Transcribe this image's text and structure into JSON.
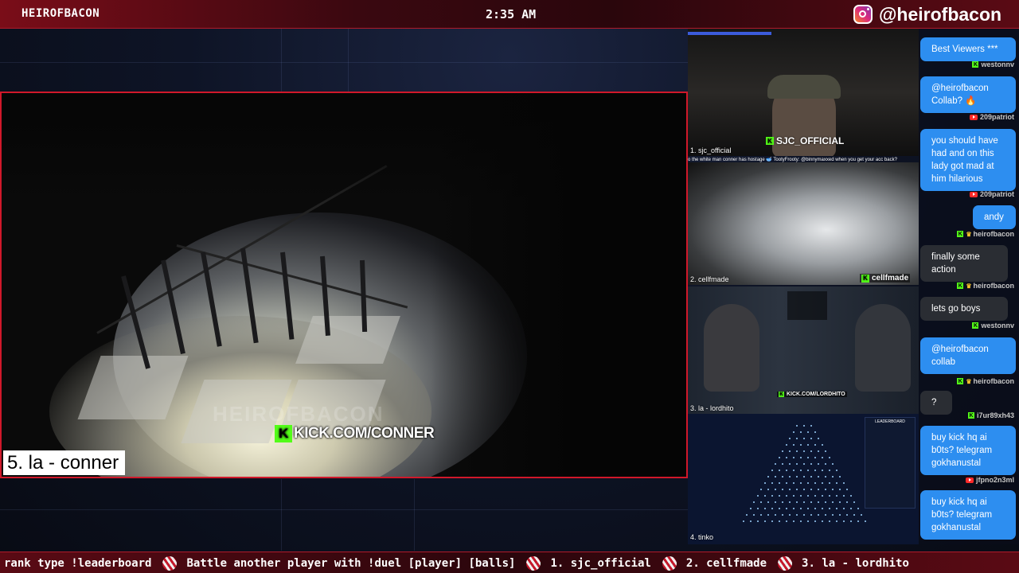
{
  "topbar": {
    "brand": "HEIROFBACON",
    "clock": "2:35 AM",
    "handle": "@heirofbacon"
  },
  "main_feed": {
    "label": "5. la - conner",
    "kick_url": "KICK.COM/CONNER",
    "watermark": "HEIROFBACON"
  },
  "side_feeds": [
    {
      "label": "1. sjc_official",
      "tag": "SJC_OFFICIAL",
      "chat_line": "o the white man conner has hostage 🥣 TootyFrooty: @binnymaxxed when you get your acc back?"
    },
    {
      "label": "2. cellfmade",
      "tag": "cellfmade"
    },
    {
      "label": "3. la - lordhito",
      "tag": "KICK.COM/LORDHITO"
    },
    {
      "label": "4. tinko",
      "board_title": "LEADERBOARD"
    }
  ],
  "chat": {
    "messages": [
      {
        "side": "blue",
        "text": "Best Viewers ***"
      },
      {
        "side": "name",
        "badge": "k",
        "user": "westonnv"
      },
      {
        "side": "blue",
        "text": "@heirofbacon Collab? 🔥"
      },
      {
        "side": "name",
        "badge": "yt",
        "user": "209patriot"
      },
      {
        "side": "blue",
        "text": "you should have had and on this lady got mad at him hilarious"
      },
      {
        "side": "name",
        "badge": "yt",
        "user": "209patriot"
      },
      {
        "side": "blue",
        "text": "andy"
      },
      {
        "side": "name",
        "badge": "kcrown",
        "user": "heirofbacon"
      },
      {
        "side": "gray",
        "text": "finally some action"
      },
      {
        "side": "name",
        "badge": "kcrown",
        "user": "heirofbacon"
      },
      {
        "side": "gray",
        "text": "lets go boys"
      },
      {
        "side": "name",
        "badge": "k",
        "user": "westonnv"
      },
      {
        "side": "blue",
        "text": "@heirofbacon collab"
      },
      {
        "side": "name",
        "badge": "kcrown",
        "user": "heirofbacon"
      },
      {
        "side": "gray",
        "text": "?"
      },
      {
        "side": "name",
        "badge": "k",
        "user": "i7ur89xh43"
      },
      {
        "side": "blue",
        "text": "buy kick hq ai b0ts? telegram gokhanustal"
      },
      {
        "side": "name",
        "badge": "yt",
        "user": "jfpno2n3ml"
      },
      {
        "side": "blue",
        "text": "buy kick hq ai b0ts? telegram gokhanustal"
      }
    ]
  },
  "ticker": {
    "items": [
      "rank type !leaderboard",
      "Battle another player with !duel [player] [balls]",
      "1. sjc_official",
      "2. cellfmade",
      "3. la - lordhito"
    ]
  },
  "colors": {
    "accent_red": "#d0182a",
    "kick_green": "#53fc18",
    "chat_blue": "#2d8ef0",
    "chat_gray": "#2a2d33"
  }
}
